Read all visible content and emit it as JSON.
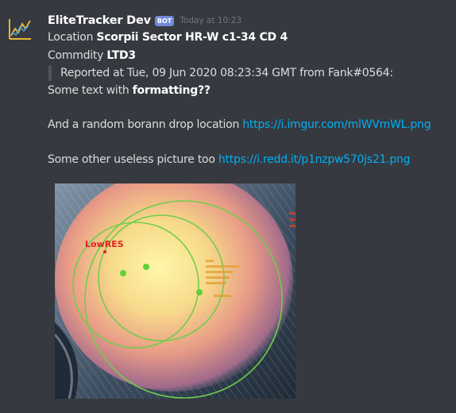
{
  "author": {
    "name": "EliteTracker Dev",
    "bot_badge": "BOT",
    "timestamp": "Today at 10:23",
    "avatar_icon": "elite-tracker-chart-icon"
  },
  "message": {
    "location_label": "Location",
    "location_value": "Scorpii Sector HR-W c1-34 CD 4",
    "commodity_label": "Commdity",
    "commodity_value": "LTD3",
    "quote_text": "Reported at Tue, 09 Jun 2020 08:23:34 GMT from Fank#0564:",
    "formatting_prefix": "Some text with",
    "formatting_bold": "formatting??",
    "drop_text": "And a random borann drop location",
    "drop_link": "https://i.imgur.com/mlWVmWL.png",
    "picture_text": "Some other useless picture too",
    "picture_link": "https://i.redd.it/p1nzpw570js21.png"
  },
  "image": {
    "lowres_label": "LowRES"
  },
  "colors": {
    "background": "#36393f",
    "link": "#00b0f4",
    "bot_badge": "#7289da",
    "circle": "#6fcf4a",
    "marker_red": "#e02020"
  }
}
